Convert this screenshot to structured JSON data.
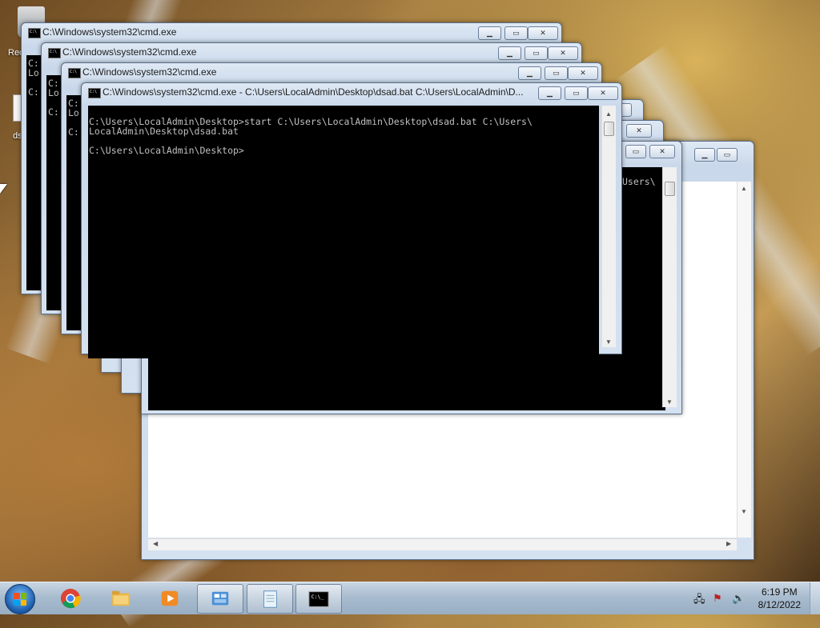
{
  "desktop": {
    "icons": [
      {
        "label": "Rec"
      },
      {
        "label": "ds"
      }
    ]
  },
  "windows": [
    {
      "title": "C:\\Windows\\system32\\cmd.exe",
      "lines": "C:\nLo\n\nC:"
    },
    {
      "title": "C:\\Windows\\system32\\cmd.exe",
      "lines": "C:\nLo\n\nC:"
    },
    {
      "title": "C:\\Windows\\system32\\cmd.exe",
      "lines": "C:\nLo\n\nC:"
    },
    {
      "title": "C:\\Windows\\system32\\cmd.exe - C:\\Users\\LocalAdmin\\Desktop\\dsad.bat  C:\\Users\\LocalAdmin\\D...",
      "lines": "C:\\Users\\LocalAdmin\\Desktop>start C:\\Users\\LocalAdmin\\Desktop\\dsad.bat C:\\Users\\\nLocalAdmin\\Desktop\\dsad.bat\n\nC:\\Users\\LocalAdmin\\Desktop>"
    }
  ],
  "behind_window": {
    "visible_text": "Users\\"
  },
  "taskbar": {
    "apps": [
      {
        "icon": "chrome-icon"
      },
      {
        "icon": "file-explorer-icon"
      },
      {
        "icon": "media-player-icon"
      },
      {
        "icon": "control-panel-icon"
      },
      {
        "icon": "notepad-icon"
      },
      {
        "icon": "cmd-icon"
      }
    ],
    "clock": {
      "time": "6:19 PM",
      "date": "8/12/2022"
    }
  }
}
